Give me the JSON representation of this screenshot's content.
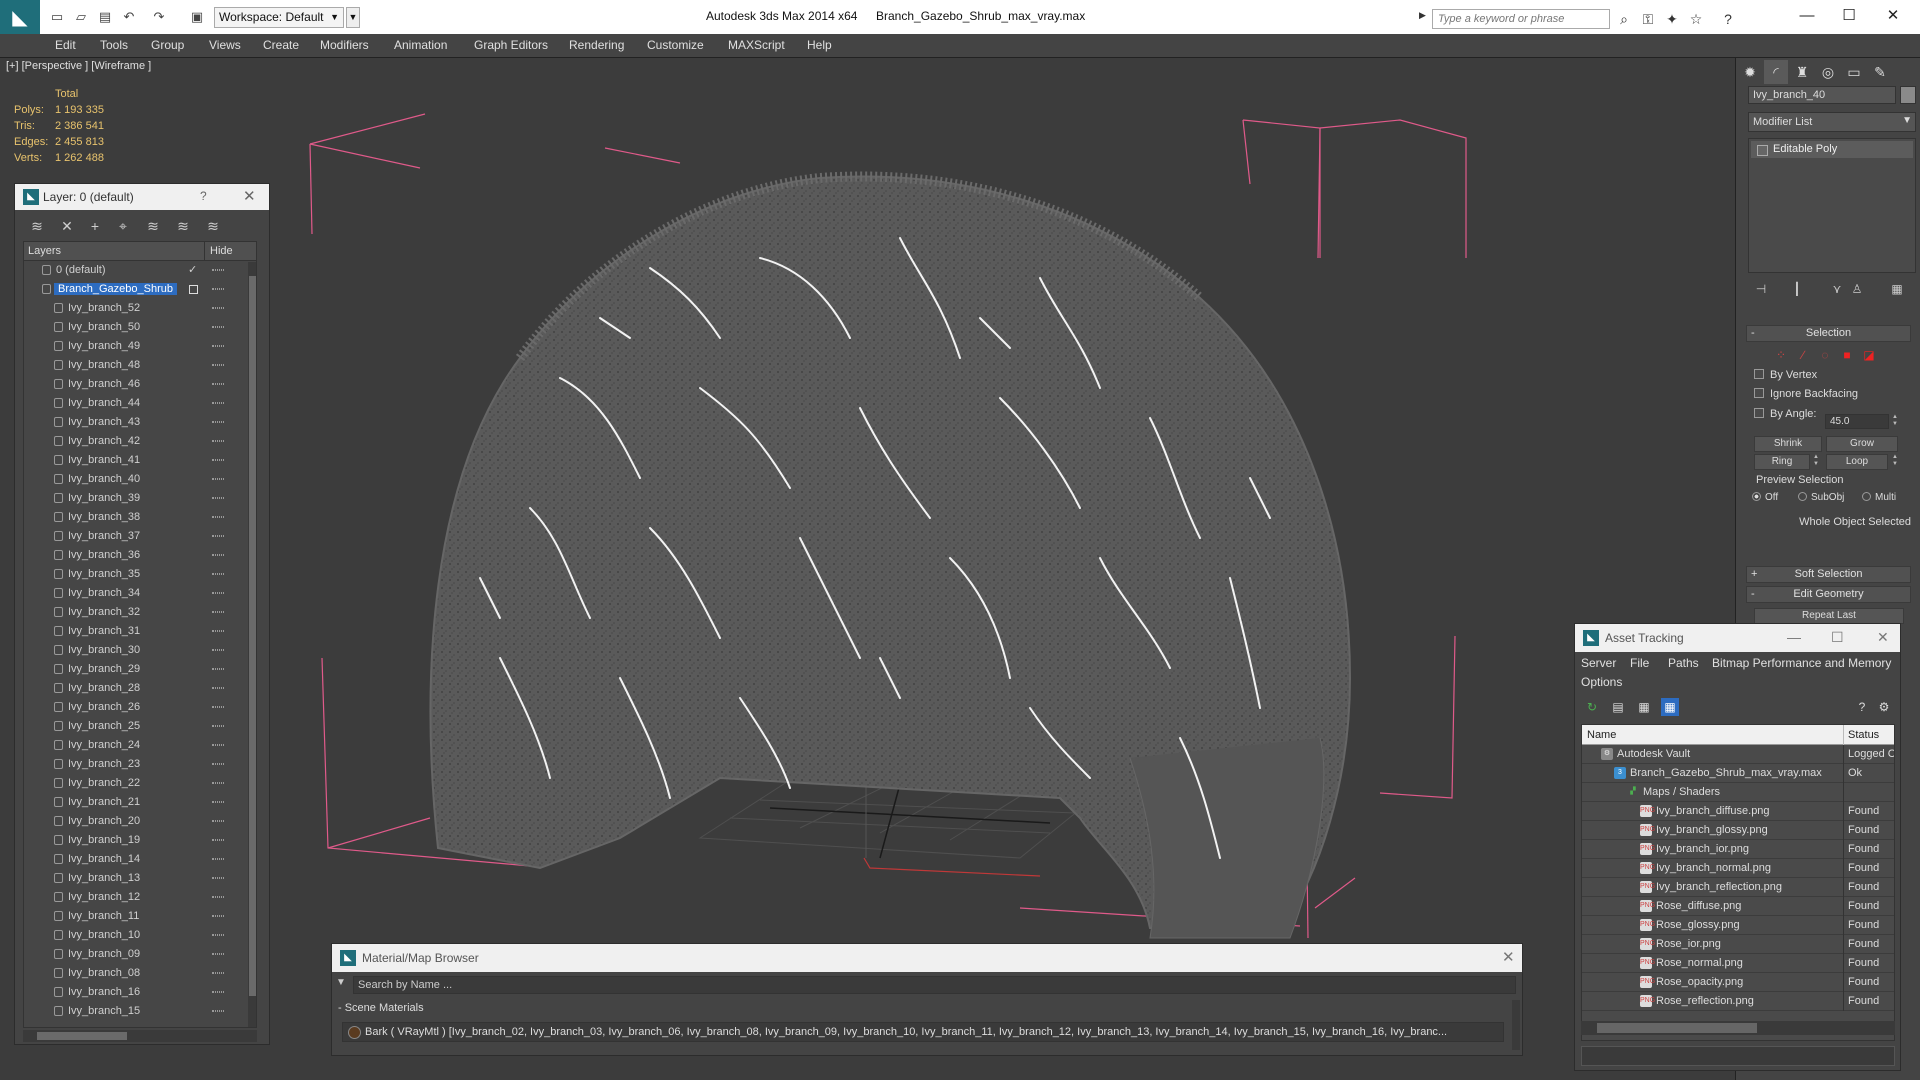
{
  "titlebar": {
    "workspace": "Workspace: Default",
    "app_title": "Autodesk 3ds Max  2014 x64",
    "file_title": "Branch_Gazebo_Shrub_max_vray.max",
    "search_placeholder": "Type a keyword or phrase"
  },
  "menu": [
    "Edit",
    "Tools",
    "Group",
    "Views",
    "Create",
    "Modifiers",
    "Animation",
    "Graph Editors",
    "Rendering",
    "Customize",
    "MAXScript",
    "Help"
  ],
  "viewport": {
    "label": "[+] [Perspective ] [Wireframe ]",
    "stats": {
      "header": "Total",
      "rows": [
        {
          "label": "Polys:",
          "value": "1 193 335"
        },
        {
          "label": "Tris:",
          "value": "2 386 541"
        },
        {
          "label": "Edges:",
          "value": "2 455 813"
        },
        {
          "label": "Verts:",
          "value": "1 262 488"
        }
      ]
    }
  },
  "layer_panel": {
    "title": "Layer: 0 (default)",
    "help": "?",
    "col_layers": "Layers",
    "col_hide": "Hide",
    "layers": [
      {
        "name": "0 (default)",
        "level": 1,
        "active": true,
        "selected": false
      },
      {
        "name": "Branch_Gazebo_Shrub",
        "level": 1,
        "active": false,
        "selected": true
      },
      {
        "name": "Ivy_branch_52",
        "level": 2
      },
      {
        "name": "Ivy_branch_50",
        "level": 2
      },
      {
        "name": "Ivy_branch_49",
        "level": 2
      },
      {
        "name": "Ivy_branch_48",
        "level": 2
      },
      {
        "name": "Ivy_branch_46",
        "level": 2
      },
      {
        "name": "Ivy_branch_44",
        "level": 2
      },
      {
        "name": "Ivy_branch_43",
        "level": 2
      },
      {
        "name": "Ivy_branch_42",
        "level": 2
      },
      {
        "name": "Ivy_branch_41",
        "level": 2
      },
      {
        "name": "Ivy_branch_40",
        "level": 2
      },
      {
        "name": "Ivy_branch_39",
        "level": 2
      },
      {
        "name": "Ivy_branch_38",
        "level": 2
      },
      {
        "name": "Ivy_branch_37",
        "level": 2
      },
      {
        "name": "Ivy_branch_36",
        "level": 2
      },
      {
        "name": "Ivy_branch_35",
        "level": 2
      },
      {
        "name": "Ivy_branch_34",
        "level": 2
      },
      {
        "name": "Ivy_branch_32",
        "level": 2
      },
      {
        "name": "Ivy_branch_31",
        "level": 2
      },
      {
        "name": "Ivy_branch_30",
        "level": 2
      },
      {
        "name": "Ivy_branch_29",
        "level": 2
      },
      {
        "name": "Ivy_branch_28",
        "level": 2
      },
      {
        "name": "Ivy_branch_26",
        "level": 2
      },
      {
        "name": "Ivy_branch_25",
        "level": 2
      },
      {
        "name": "Ivy_branch_24",
        "level": 2
      },
      {
        "name": "Ivy_branch_23",
        "level": 2
      },
      {
        "name": "Ivy_branch_22",
        "level": 2
      },
      {
        "name": "Ivy_branch_21",
        "level": 2
      },
      {
        "name": "Ivy_branch_20",
        "level": 2
      },
      {
        "name": "Ivy_branch_19",
        "level": 2
      },
      {
        "name": "Ivy_branch_14",
        "level": 2
      },
      {
        "name": "Ivy_branch_13",
        "level": 2
      },
      {
        "name": "Ivy_branch_12",
        "level": 2
      },
      {
        "name": "Ivy_branch_11",
        "level": 2
      },
      {
        "name": "Ivy_branch_10",
        "level": 2
      },
      {
        "name": "Ivy_branch_09",
        "level": 2
      },
      {
        "name": "Ivy_branch_08",
        "level": 2
      },
      {
        "name": "Ivy_branch_16",
        "level": 2
      },
      {
        "name": "Ivy_branch_15",
        "level": 2
      }
    ]
  },
  "command_panel": {
    "object_name": "Ivy_branch_40",
    "modifier_list": "Modifier List",
    "stack_item": "Editable Poly",
    "selection": {
      "title": "Selection",
      "by_vertex": "By Vertex",
      "ignore_backfacing": "Ignore Backfacing",
      "by_angle": "By Angle:",
      "angle_value": "45.0",
      "shrink": "Shrink",
      "grow": "Grow",
      "ring": "Ring",
      "loop": "Loop",
      "preview_selection": "Preview Selection",
      "preview_options": [
        "Off",
        "SubObj",
        "Multi"
      ],
      "status": "Whole Object Selected"
    },
    "soft_selection": "Soft Selection",
    "edit_geometry": "Edit Geometry",
    "repeat_last": "Repeat Last"
  },
  "asset_tracking": {
    "title": "Asset Tracking",
    "menu": [
      "Server",
      "File",
      "Paths",
      "Bitmap Performance and Memory",
      "Options"
    ],
    "col_name": "Name",
    "col_status": "Status",
    "rows": [
      {
        "name": "Autodesk Vault",
        "status": "Logged C",
        "level": 1,
        "icon": "vault"
      },
      {
        "name": "Branch_Gazebo_Shrub_max_vray.max",
        "status": "Ok",
        "level": 2,
        "icon": "max"
      },
      {
        "name": "Maps / Shaders",
        "status": "",
        "level": 3,
        "icon": "maps"
      },
      {
        "name": "Ivy_branch_diffuse.png",
        "status": "Found",
        "level": 4,
        "icon": "png"
      },
      {
        "name": "Ivy_branch_glossy.png",
        "status": "Found",
        "level": 4,
        "icon": "png"
      },
      {
        "name": "Ivy_branch_ior.png",
        "status": "Found",
        "level": 4,
        "icon": "png"
      },
      {
        "name": "Ivy_branch_normal.png",
        "status": "Found",
        "level": 4,
        "icon": "png"
      },
      {
        "name": "Ivy_branch_reflection.png",
        "status": "Found",
        "level": 4,
        "icon": "png"
      },
      {
        "name": "Rose_diffuse.png",
        "status": "Found",
        "level": 4,
        "icon": "png"
      },
      {
        "name": "Rose_glossy.png",
        "status": "Found",
        "level": 4,
        "icon": "png"
      },
      {
        "name": "Rose_ior.png",
        "status": "Found",
        "level": 4,
        "icon": "png"
      },
      {
        "name": "Rose_normal.png",
        "status": "Found",
        "level": 4,
        "icon": "png"
      },
      {
        "name": "Rose_opacity.png",
        "status": "Found",
        "level": 4,
        "icon": "png"
      },
      {
        "name": "Rose_reflection.png",
        "status": "Found",
        "level": 4,
        "icon": "png"
      }
    ]
  },
  "material_browser": {
    "title": "Material/Map Browser",
    "search_placeholder": "Search by Name ...",
    "group": "- Scene Materials",
    "material": "Bark  ( VRayMtl )  [Ivy_branch_02, Ivy_branch_03, Ivy_branch_06, Ivy_branch_08, Ivy_branch_09, Ivy_branch_10, Ivy_branch_11, Ivy_branch_12, Ivy_branch_13, Ivy_branch_14, Ivy_branch_15, Ivy_branch_16, Ivy_branc..."
  },
  "colors": {
    "ui_bg": "#444444",
    "viewport_bg": "#3c3c3c",
    "selection_blue": "#2d6cc0",
    "stats_yellow": "#e8c36d",
    "bbox_pink": "#e05a8a",
    "brand_teal": "#1f6e7a"
  }
}
